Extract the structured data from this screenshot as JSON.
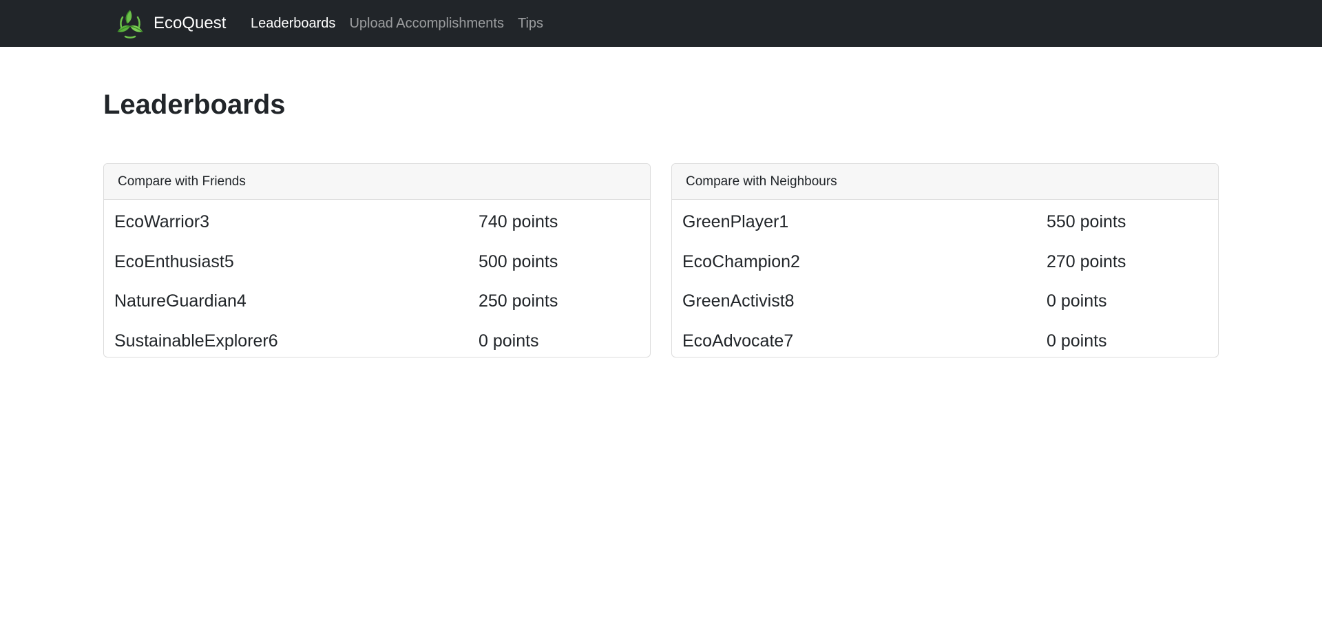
{
  "navbar": {
    "brand": "EcoQuest",
    "logo_icon": "recycle-leaves-icon",
    "links": [
      {
        "label": "Leaderboards",
        "active": true
      },
      {
        "label": "Upload Accomplishments",
        "active": false
      },
      {
        "label": "Tips",
        "active": false
      }
    ]
  },
  "page": {
    "title": "Leaderboards"
  },
  "friends": {
    "header": "Compare with Friends",
    "rows": [
      {
        "name": "EcoWarrior3",
        "points": "740 points"
      },
      {
        "name": "EcoEnthusiast5",
        "points": "500 points"
      },
      {
        "name": "NatureGuardian4",
        "points": "250 points"
      },
      {
        "name": "SustainableExplorer6",
        "points": "0 points"
      }
    ]
  },
  "neighbours": {
    "header": "Compare with Neighbours",
    "rows": [
      {
        "name": "GreenPlayer1",
        "points": "550 points"
      },
      {
        "name": "EcoChampion2",
        "points": "270 points"
      },
      {
        "name": "GreenActivist8",
        "points": "0 points"
      },
      {
        "name": "EcoAdvocate7",
        "points": "0 points"
      }
    ]
  },
  "colors": {
    "navbar_bg": "#212529",
    "logo_green": "#6cc24a"
  }
}
